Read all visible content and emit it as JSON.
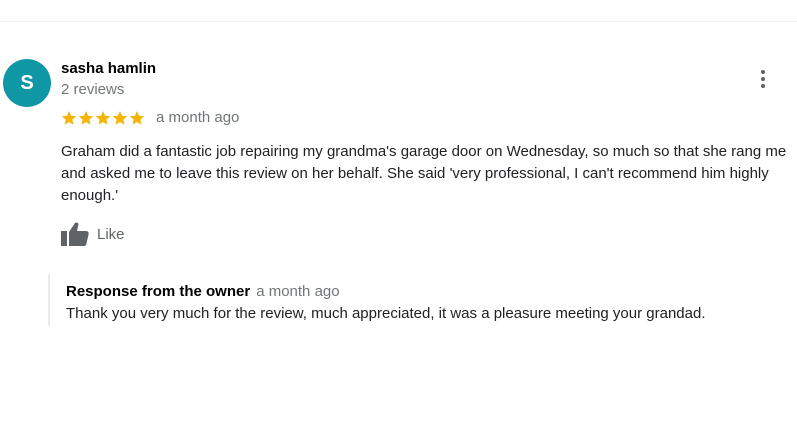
{
  "review": {
    "avatar_initial": "S",
    "avatar_color": "#0f97a5",
    "author_name": "sasha hamlin",
    "review_count": "2 reviews",
    "rating": 5,
    "rating_max": 5,
    "star_color": "#f4b400",
    "timestamp": "a month ago",
    "text": "Graham did a fantastic job repairing my grandma's garage door on Wednesday, so much so that she rang me and asked me to leave this review on her behalf. She said 'very professional, I can't recommend him highly enough.'",
    "like_label": "Like",
    "like_icon": "thumbs-up-icon",
    "more_icon": "more-vert-icon"
  },
  "owner_response": {
    "title": "Response from the owner",
    "timestamp": "a month ago",
    "text": "Thank you very much for the review, much appreciated, it was a pleasure meeting your grandad."
  }
}
